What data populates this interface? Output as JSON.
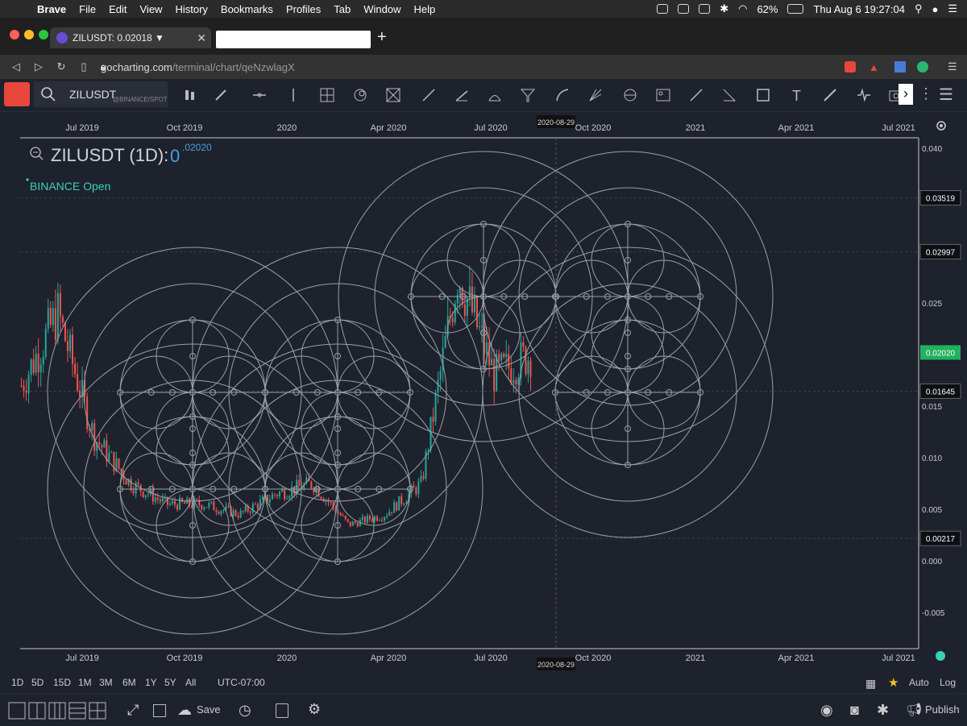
{
  "menubar": {
    "app": "Brave",
    "items": [
      "File",
      "Edit",
      "View",
      "History",
      "Bookmarks",
      "Profiles",
      "Tab",
      "Window",
      "Help"
    ],
    "battery": "62%",
    "clock": "Thu Aug 6  19:27:04"
  },
  "tabbar": {
    "tab_title": "ZILUSDT: 0.02018 ▼"
  },
  "addressbar": {
    "url_host": "gocharting.com",
    "url_path": "/terminal/chart/qeNzwlagX"
  },
  "toolbar": {
    "symbol": "ZILUSDT",
    "exchange": "@BINANCE/SPOT"
  },
  "chart": {
    "legend_title": "ZILUSDT (1D):",
    "legend_value_big": "0",
    "legend_value_small": ".02020",
    "status": "BINANCE Open",
    "x_ticks": [
      "Jul 2019",
      "Oct 2019",
      "2020",
      "Apr 2020",
      "Jul 2020",
      "Oct 2020",
      "2021",
      "Apr 2021",
      "Jul 2021"
    ],
    "y_ticks": [
      "0.040",
      "0.025",
      "0.015",
      "0.010",
      "0.005",
      "0.000",
      "-0.005"
    ],
    "price_tags": [
      "0.03519",
      "0.02997",
      "0.01645",
      "0.00217"
    ],
    "current_price": "0.02020",
    "crosshair_date": "2020-08-29",
    "colors": {
      "up": "#26a69a",
      "down": "#ef5350",
      "current": "#21b15f",
      "circles": "#9aa0a6",
      "background": "#1e222d"
    }
  },
  "chart_data": {
    "type": "candlestick",
    "title": "ZILUSDT (1D)",
    "xlabel": "",
    "ylabel": "",
    "ylim": [
      -0.008,
      0.041
    ],
    "x": [
      "2019-06",
      "2019-07",
      "2019-08",
      "2019-09",
      "2019-10",
      "2019-11",
      "2019-12",
      "2020-01",
      "2020-02",
      "2020-03",
      "2020-04",
      "2020-05",
      "2020-06",
      "2020-07",
      "2020-08"
    ],
    "values": [
      0.017,
      0.024,
      0.012,
      0.0075,
      0.0055,
      0.0055,
      0.0045,
      0.0065,
      0.0075,
      0.0035,
      0.0045,
      0.0075,
      0.028,
      0.018,
      0.02
    ],
    "last_close": 0.0202
  },
  "bottom": {
    "ranges": [
      "1D",
      "5D",
      "15D",
      "1M",
      "3M",
      "6M",
      "1Y",
      "5Y",
      "All"
    ],
    "timezone": "UTC-07:00",
    "auto": "Auto",
    "log": "Log",
    "save": "Save",
    "publish": "Publish"
  }
}
